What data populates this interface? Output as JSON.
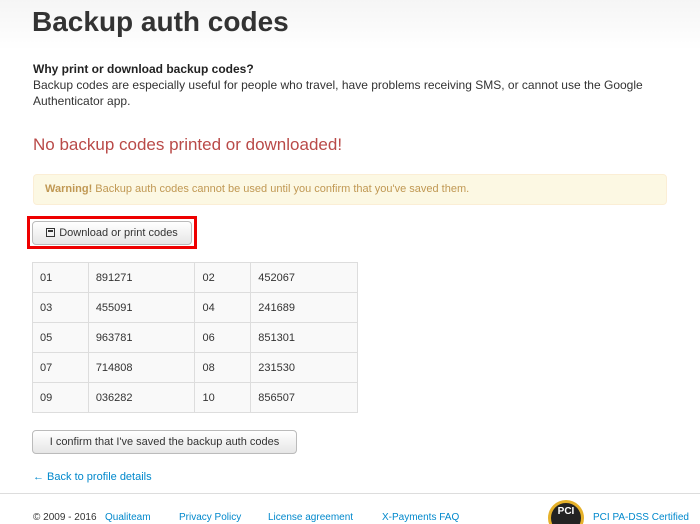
{
  "page": {
    "title": "Backup auth codes"
  },
  "why": {
    "heading": "Why print or download backup codes?",
    "text": "Backup codes are especially useful for people who travel, have problems receiving SMS, or cannot use the Google Authenticator app."
  },
  "error_title": "No backup codes printed or downloaded!",
  "warning": {
    "strong": "Warning!",
    "text": " Backup auth codes cannot be used until you confirm that you've saved them."
  },
  "download_button": {
    "label": "Download or print codes",
    "icon": "save-icon"
  },
  "codes": [
    {
      "n1": "01",
      "c1": "891271",
      "n2": "02",
      "c2": "452067"
    },
    {
      "n1": "03",
      "c1": "455091",
      "n2": "04",
      "c2": "241689"
    },
    {
      "n1": "05",
      "c1": "963781",
      "n2": "06",
      "c2": "851301"
    },
    {
      "n1": "07",
      "c1": "714808",
      "n2": "08",
      "c2": "231530"
    },
    {
      "n1": "09",
      "c1": "036282",
      "n2": "10",
      "c2": "856507"
    }
  ],
  "confirm_button": {
    "label": "I confirm that I've saved the backup auth codes"
  },
  "back_link": "← Back to profile details",
  "footer": {
    "copyright": "© 2009 - 2016",
    "links": [
      "Qualiteam",
      "Privacy Policy",
      "License agreement",
      "X-Payments FAQ"
    ],
    "pci_badge_text": "PCI",
    "pci_label": "PCI PA-DSS Certified"
  },
  "colors": {
    "link": "#0088cc",
    "error": "#b94a48",
    "warning_text": "#c09853",
    "warning_bg": "#fcf8e3",
    "highlight": "#ee0000"
  }
}
